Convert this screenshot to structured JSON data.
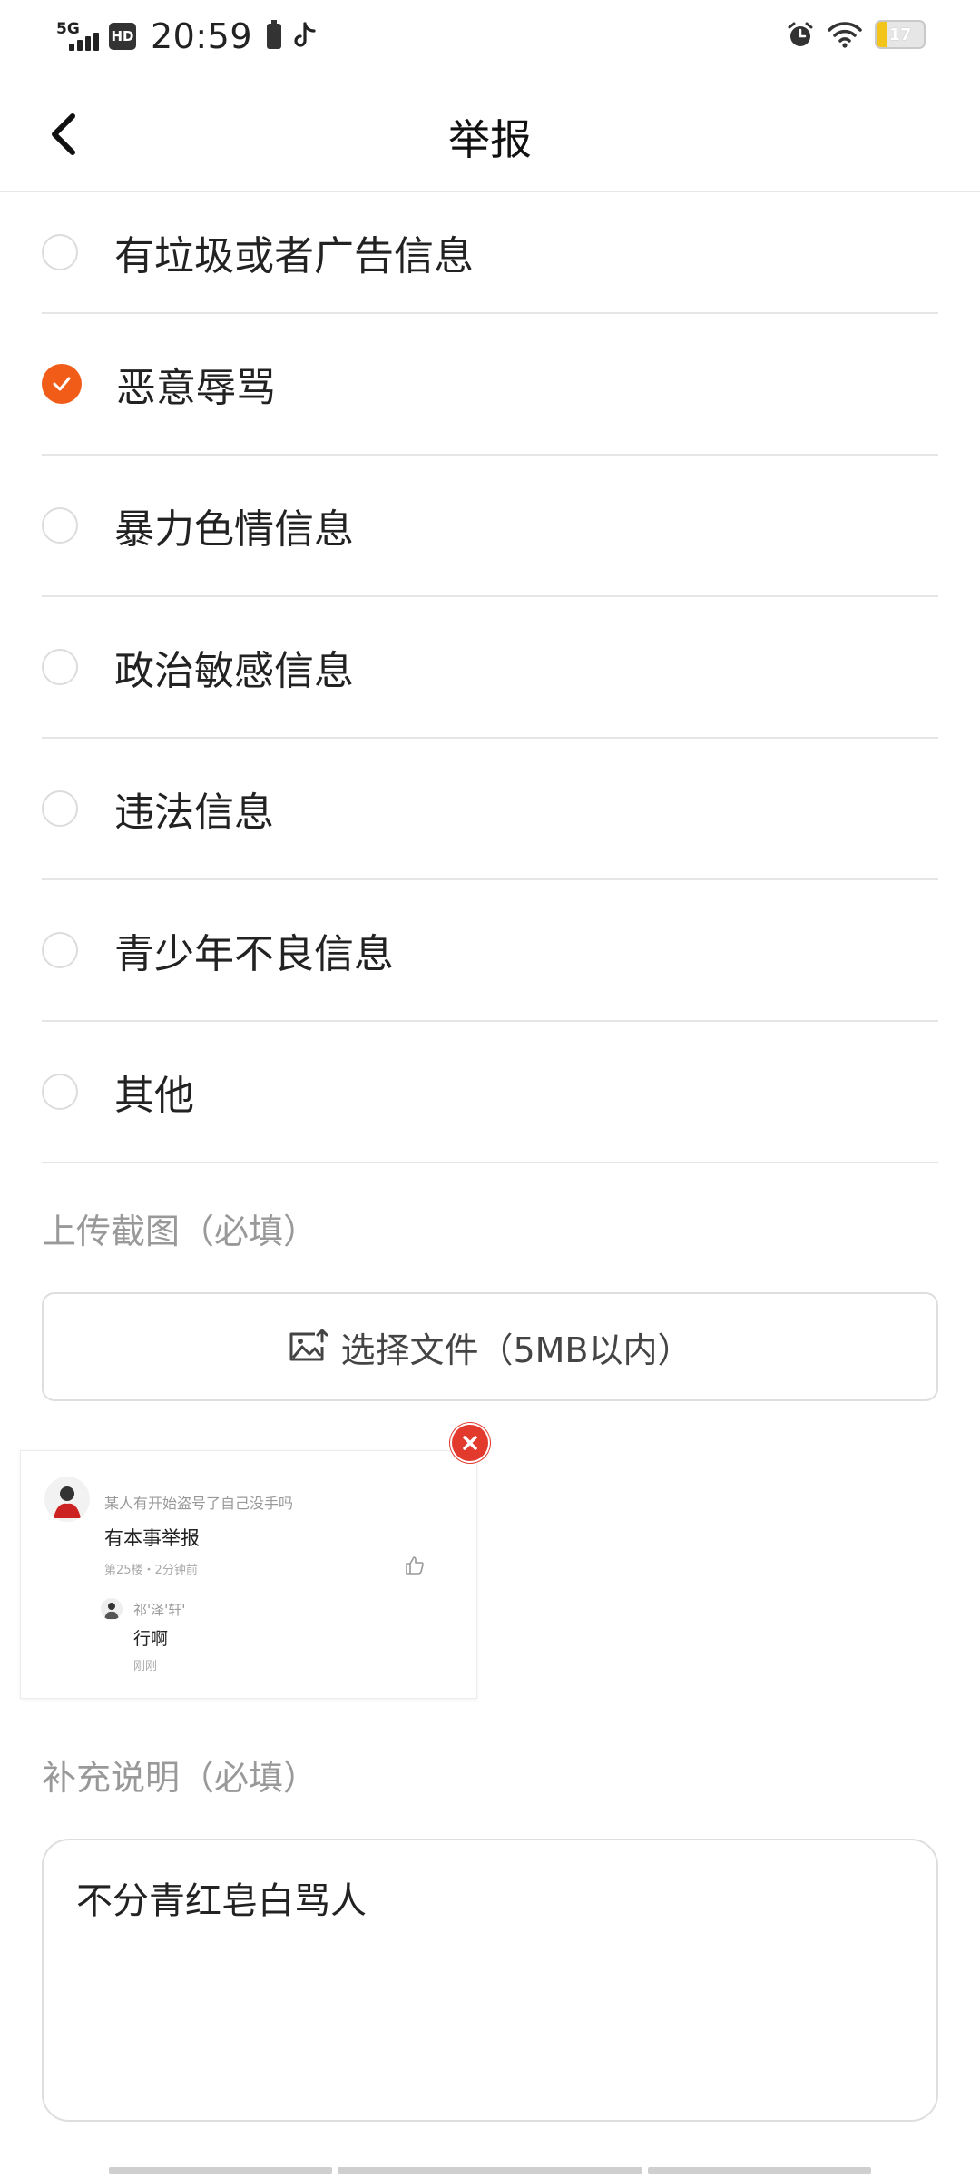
{
  "status_bar": {
    "network": "5G",
    "hd": "HD",
    "time": "20:59",
    "battery": "17",
    "battery_color": "#f3c51b"
  },
  "header": {
    "title": "举报"
  },
  "options": [
    {
      "label": "有垃圾或者广告信息",
      "selected": false
    },
    {
      "label": "恶意辱骂",
      "selected": true
    },
    {
      "label": "暴力色情信息",
      "selected": false
    },
    {
      "label": "政治敏感信息",
      "selected": false
    },
    {
      "label": "违法信息",
      "selected": false
    },
    {
      "label": "青少年不良信息",
      "selected": false
    },
    {
      "label": "其他",
      "selected": false
    }
  ],
  "accent_color": "#f25c19",
  "upload": {
    "section_label": "上传截图（必填）",
    "button_label": "选择文件（5MB以内）"
  },
  "screenshot_thumb": {
    "line1": "某人有开始盗号了自己没手吗",
    "line2": "有本事举报",
    "line3": "第25楼・2分钟前",
    "reply_user": "祁'泽'轩'",
    "reply_text": "行啊",
    "reply_time": "刚刚"
  },
  "description": {
    "section_label": "补充说明（必填）",
    "value": "不分青红皂白骂人"
  }
}
